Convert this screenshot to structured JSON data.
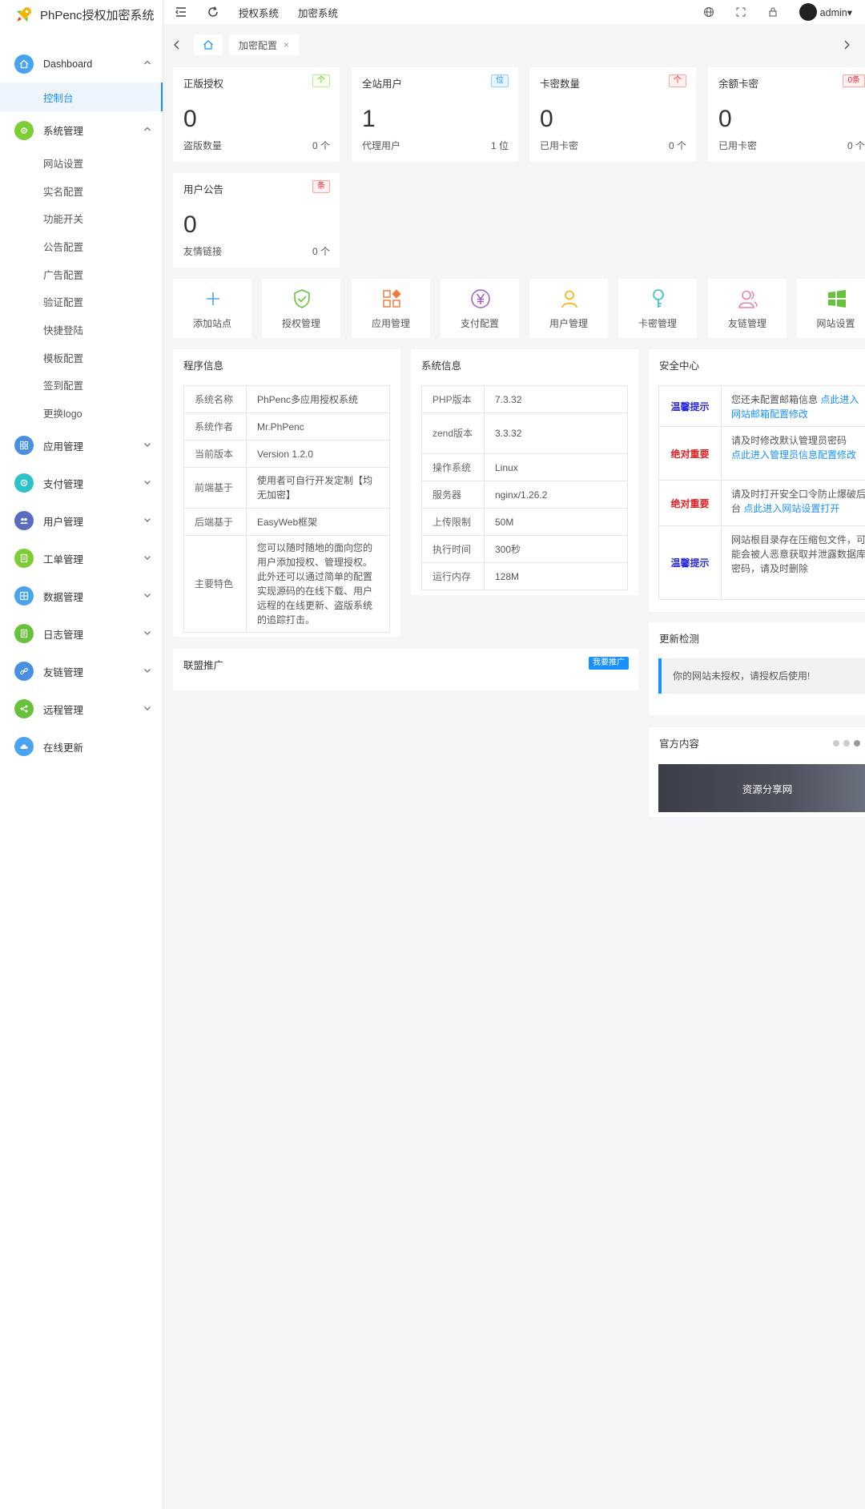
{
  "app": {
    "title": "PhPenc授权加密系统"
  },
  "sidebar": {
    "dashboard": "Dashboard",
    "console": "控制台",
    "system": "系统管理",
    "system_items": [
      "网站设置",
      "实名配置",
      "功能开关",
      "公告配置",
      "广告配置",
      "验证配置",
      "快捷登陆",
      "模板配置",
      "签到配置",
      "更换logo"
    ],
    "groups": [
      {
        "label": "应用管理",
        "color": "#4a90e2"
      },
      {
        "label": "支付管理",
        "color": "#2bc3c9"
      },
      {
        "label": "用户管理",
        "color": "#5b6bc0"
      },
      {
        "label": "工单管理",
        "color": "#7ccd36"
      },
      {
        "label": "数据管理",
        "color": "#4aa3f0"
      },
      {
        "label": "日志管理",
        "color": "#67c23a"
      },
      {
        "label": "友链管理",
        "color": "#4a90e2"
      },
      {
        "label": "远程管理",
        "color": "#67c23a"
      },
      {
        "label": "在线更新",
        "color": "#4aa3f0"
      }
    ]
  },
  "topbar": {
    "links": [
      "授权系统",
      "加密系统"
    ],
    "user": "admin"
  },
  "tabs": {
    "current": "加密配置",
    "close": "×"
  },
  "stats": [
    {
      "title": "正版授权",
      "badge": "个",
      "num": "0",
      "foot": "盗版数量",
      "footv": "0 个"
    },
    {
      "title": "全站用户",
      "badge": "位",
      "num": "1",
      "foot": "代理用户",
      "footv": "1 位"
    },
    {
      "title": "卡密数量",
      "badge": "个",
      "num": "0",
      "foot": "已用卡密",
      "footv": "0 个"
    },
    {
      "title": "余额卡密",
      "badge": "0条",
      "num": "0",
      "foot": "已用卡密",
      "footv": "0 个"
    },
    {
      "title": "用户公告",
      "badge": "条",
      "num": "0",
      "foot": "友情链接",
      "footv": "0 个"
    }
  ],
  "shortcuts": [
    {
      "label": "添加站点",
      "icon": "plus-icon",
      "color": "#4aa3f0"
    },
    {
      "label": "授权管理",
      "icon": "shield-check-icon",
      "color": "#67c23a"
    },
    {
      "label": "应用管理",
      "icon": "apps-icon",
      "color": "#f07c3c"
    },
    {
      "label": "支付配置",
      "icon": "yen-icon",
      "color": "#a05cc8"
    },
    {
      "label": "用户管理",
      "icon": "user-icon",
      "color": "#f0b400"
    },
    {
      "label": "卡密管理",
      "icon": "key-icon",
      "color": "#2bc3c9"
    },
    {
      "label": "友链管理",
      "icon": "users-icon",
      "color": "#e77fb3"
    },
    {
      "label": "网站设置",
      "icon": "windows-icon",
      "color": "#67c23a"
    }
  ],
  "program": {
    "title": "程序信息",
    "rows": [
      {
        "k": "系统名称",
        "v": "PhPenc多应用授权系统"
      },
      {
        "k": "系统作者",
        "v": "Mr.PhPenc"
      },
      {
        "k": "当前版本",
        "v": "Version 1.2.0"
      },
      {
        "k": "前端基于",
        "v": "使用者可自行开发定制【均无加密】"
      },
      {
        "k": "后端基于",
        "v": "EasyWeb框架"
      },
      {
        "k": "主要特色",
        "v": "您可以随时随地的面向您的用户添加授权、管理授权。此外还可以通过简单的配置实现源码的在线下载、用户远程的在线更新、盗版系统的追踪打击。"
      }
    ]
  },
  "sysinfo": {
    "title": "系统信息",
    "rows": [
      {
        "k": "PHP版本",
        "v": "7.3.32"
      },
      {
        "k": "zend版本",
        "v": "3.3.32"
      },
      {
        "k": "操作系统",
        "v": "Linux"
      },
      {
        "k": "服务器",
        "v": "nginx/1.26.2"
      },
      {
        "k": "上传限制",
        "v": "50M"
      },
      {
        "k": "执行时间",
        "v": "300秒"
      },
      {
        "k": "运行内存",
        "v": "128M"
      }
    ]
  },
  "promo": {
    "title": "联盟推广",
    "button": "我要推广"
  },
  "security": {
    "title": "安全中心",
    "rows": [
      {
        "k": "温馨提示",
        "color": "#2b2bd6",
        "text": "您还未配置邮箱信息",
        "link": "点此进入网站邮箱配置修改"
      },
      {
        "k": "绝对重要",
        "color": "#e02020",
        "text": "请及时修改默认管理员密码",
        "link": "点此进入管理员信息配置修改"
      },
      {
        "k": "绝对重要",
        "color": "#e02020",
        "text": "请及时打开安全口令防止爆破后台",
        "link": "点此进入网站设置打开"
      },
      {
        "k": "温馨提示",
        "color": "#2b2bd6",
        "text": "网站根目录存在压缩包文件，可能会被人恶意获取并泄露数据库密码，请及时删除",
        "link": ""
      }
    ]
  },
  "update": {
    "title": "更新检测",
    "message": "你的网站未授权，请授权后使用!"
  },
  "official": {
    "title": "官方内容",
    "banner": "资源分享网"
  }
}
